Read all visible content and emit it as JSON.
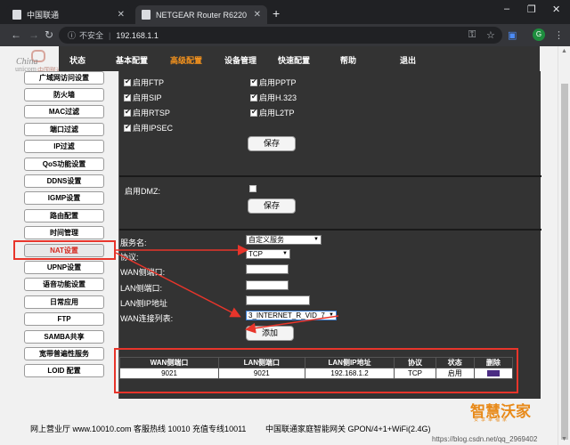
{
  "browser": {
    "tabs": [
      {
        "title": "中国联通",
        "active": false
      },
      {
        "title": "NETGEAR Router R6220",
        "active": true
      }
    ],
    "new_tab": "+",
    "security_label": "不安全",
    "url": "192.168.1.1",
    "profile_initial": "G",
    "window_controls": {
      "minimize": "–",
      "maximize": "❐",
      "close": "✕"
    }
  },
  "logo": {
    "text": "China unicom中国联通"
  },
  "topnav": {
    "items": [
      {
        "label": "状态",
        "active": false
      },
      {
        "label": "基本配置",
        "active": false
      },
      {
        "label": "高级配置",
        "active": true
      },
      {
        "label": "设备管理",
        "active": false
      },
      {
        "label": "快速配置",
        "active": false
      },
      {
        "label": "帮助",
        "active": false
      },
      {
        "label": "退出",
        "active": false
      }
    ],
    "active_color": "#f7941d"
  },
  "sidebar": {
    "items": [
      {
        "label": "广域网访问设置"
      },
      {
        "label": "防火墙"
      },
      {
        "label": "MAC过滤"
      },
      {
        "label": "端口过滤"
      },
      {
        "label": "IP过滤"
      },
      {
        "label": "QoS功能设置"
      },
      {
        "label": "DDNS设置"
      },
      {
        "label": "IGMP设置"
      },
      {
        "label": "路由配置"
      },
      {
        "label": "时间管理"
      },
      {
        "label": "NAT设置"
      },
      {
        "label": "UPNP设置"
      },
      {
        "label": "语音功能设置"
      },
      {
        "label": "日常应用"
      },
      {
        "label": "FTP"
      },
      {
        "label": "SAMBA共享"
      },
      {
        "label": "宽带普遍性服务"
      },
      {
        "label": "LOID 配置"
      }
    ],
    "active_index": 10,
    "highlight_color": "#e8352b"
  },
  "alg": {
    "checkboxes": [
      {
        "label": "启用FTP",
        "checked": true
      },
      {
        "label": "启用PPTP",
        "checked": true
      },
      {
        "label": "启用SIP",
        "checked": true
      },
      {
        "label": "启用H.323",
        "checked": true
      },
      {
        "label": "启用RTSP",
        "checked": true
      },
      {
        "label": "启用L2TP",
        "checked": true
      },
      {
        "label": "启用IPSEC",
        "checked": true
      }
    ],
    "save_label": "保存"
  },
  "dmz": {
    "label": "启用DMZ:",
    "checked": false,
    "save_label": "保存"
  },
  "vserver": {
    "service_label": "服务名:",
    "service_value": "自定义服务",
    "protocol_label": "协议:",
    "protocol_value": "TCP",
    "wan_port_label": "WAN侧端口:",
    "wan_port_value": "",
    "lan_port_label": "LAN侧端口:",
    "lan_port_value": "",
    "lan_ip_label": "LAN侧IP地址",
    "lan_ip_value": "",
    "wan_conn_label": "WAN连接列表:",
    "wan_conn_value": "3_INTERNET_R_VID_7",
    "add_label": "添加"
  },
  "rules_table": {
    "headers": [
      "WAN侧端口",
      "LAN侧端口",
      "LAN侧IP地址",
      "协议",
      "状态",
      "删除"
    ],
    "rows": [
      {
        "wan_port": "9021",
        "lan_port": "9021",
        "lan_ip": "192.168.1.2",
        "protocol": "TCP",
        "status": "启用"
      }
    ],
    "delete_color": "#4b2d83",
    "highlight_color": "#e8352b"
  },
  "footer": {
    "left": "网上营业厅 www.10010.com 客服热线 10010 充值专线10011",
    "right": "中国联通家庭智能网关 GPON/4+1+WiFi(2.4G)"
  },
  "watermark": {
    "text": "智慧沃家",
    "sub": "安享幸福家",
    "url": "https://blog.csdn.net/qq_2969402"
  }
}
